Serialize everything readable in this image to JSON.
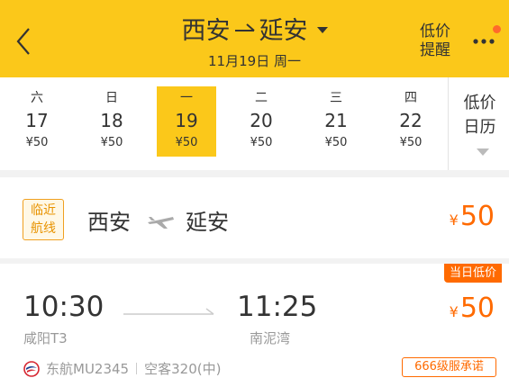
{
  "header": {
    "title_from": "西安",
    "title_to": "延安",
    "date": "11月19日 周一",
    "alert_line1": "低价",
    "alert_line2": "提醒",
    "accent_color": "#fbc81a",
    "badge_color": "#ff6a2b"
  },
  "dates": [
    {
      "weekday": "六",
      "day": "17",
      "price": "¥50",
      "selected": false
    },
    {
      "weekday": "日",
      "day": "18",
      "price": "¥50",
      "selected": false
    },
    {
      "weekday": "一",
      "day": "19",
      "price": "¥50",
      "selected": true
    },
    {
      "weekday": "二",
      "day": "20",
      "price": "¥50",
      "selected": false
    },
    {
      "weekday": "三",
      "day": "21",
      "price": "¥50",
      "selected": false
    },
    {
      "weekday": "四",
      "day": "22",
      "price": "¥50",
      "selected": false
    }
  ],
  "calendar": {
    "line1": "低价",
    "line2": "日历"
  },
  "route": {
    "tag_line1": "临近",
    "tag_line2": "航线",
    "from": "西安",
    "to": "延安",
    "currency": "¥",
    "price": "50"
  },
  "flight": {
    "badge": "当日低价",
    "dep_time": "10:30",
    "dep_airport": "咸阳T3",
    "arr_time": "11:25",
    "arr_airport": "南泥湾",
    "currency": "¥",
    "price": "50",
    "airline": "东航MU2345",
    "aircraft": "空客320(中)",
    "service": "666级服承诺",
    "price_color": "#ff6a00"
  },
  "icons": {
    "back": "chevron-left-icon",
    "more": "more-dots-icon",
    "plane": "plane-icon",
    "airline": "china-eastern-logo-icon"
  }
}
